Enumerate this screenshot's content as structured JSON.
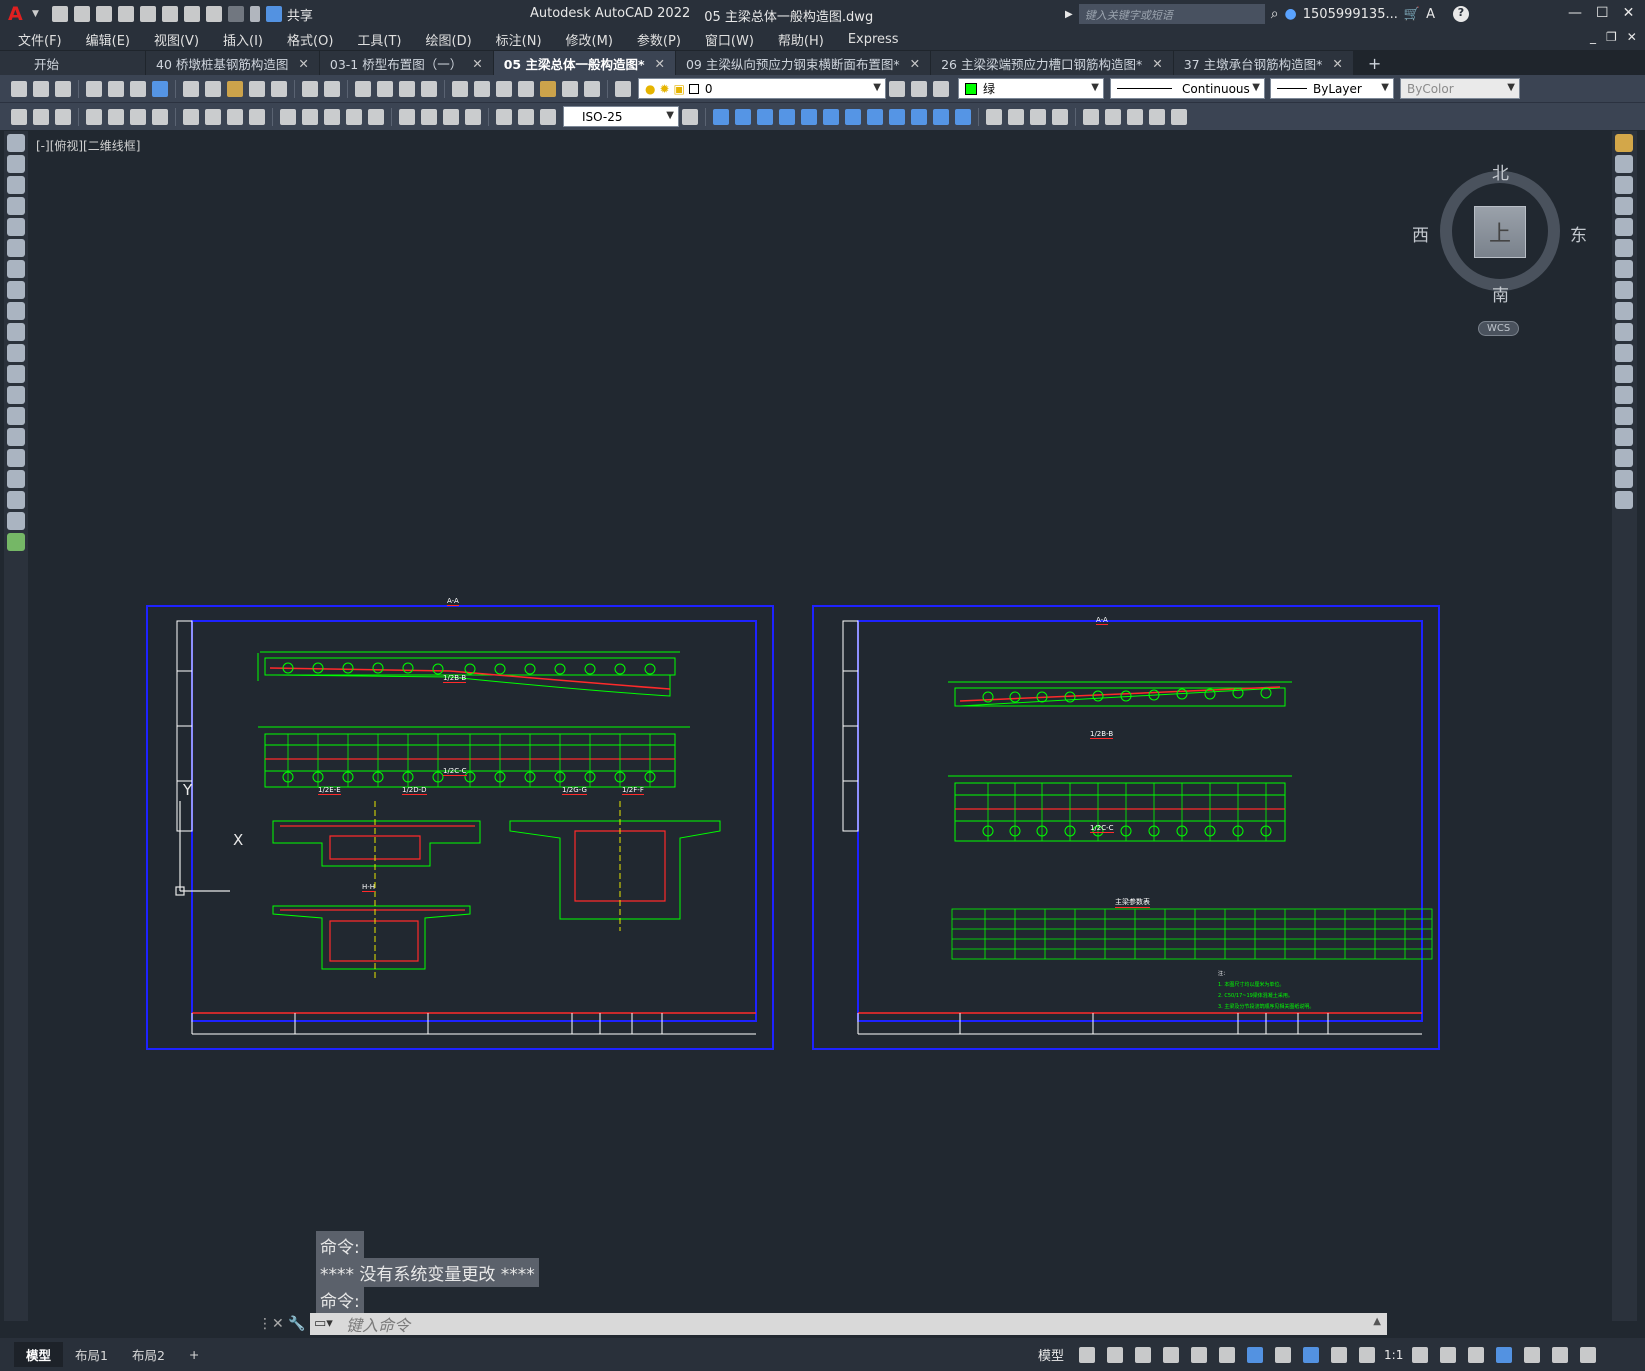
{
  "app": {
    "logo": "A",
    "title": "Autodesk AutoCAD 2022",
    "document": "05 主梁总体一般构造图.dwg",
    "share_label": "共享",
    "search_placeholder": "键入关键字或短语",
    "user": "1505999135...",
    "help": "?"
  },
  "menu": [
    "文件(F)",
    "编辑(E)",
    "视图(V)",
    "插入(I)",
    "格式(O)",
    "工具(T)",
    "绘图(D)",
    "标注(N)",
    "修改(M)",
    "参数(P)",
    "窗口(W)",
    "帮助(H)",
    "Express"
  ],
  "tabs": [
    {
      "label": "开始",
      "active": false,
      "closable": false
    },
    {
      "label": "40 桥墩桩基钢筋构造图",
      "active": false,
      "closable": true
    },
    {
      "label": "03-1 桥型布置图（一）",
      "active": false,
      "closable": true
    },
    {
      "label": "05 主梁总体一般构造图*",
      "active": true,
      "closable": true
    },
    {
      "label": "09 主梁纵向预应力钢束横断面布置图*",
      "active": false,
      "closable": true
    },
    {
      "label": "26 主梁梁端预应力槽口钢筋构造图*",
      "active": false,
      "closable": true
    },
    {
      "label": "37 主墩承台钢筋构造图*",
      "active": false,
      "closable": true
    }
  ],
  "tab_close": "✕",
  "new_tab": "+",
  "toolbar": {
    "layer": "0",
    "color": "绿",
    "linetype": "Continuous",
    "lineweight": "ByLayer",
    "plotstyle": "ByColor",
    "dimstyle": "ISO-25"
  },
  "viewport": {
    "label": "[-][俯视][二维线框]"
  },
  "viewcube": {
    "north": "北",
    "south": "南",
    "east": "东",
    "west": "西",
    "top": "上",
    "wcs": "WCS"
  },
  "ucs": {
    "x": "X",
    "y": "Y"
  },
  "drawing": {
    "left": {
      "views": [
        "A-A",
        "1/2B-B",
        "1/2C-C",
        "1/2E-E",
        "1/2D-D",
        "1/2G-G",
        "1/2F-F",
        "H-H"
      ]
    },
    "right": {
      "views": [
        "A-A",
        "1/2B-B",
        "1/2C-C"
      ],
      "table_title": "主梁参数表",
      "notes": [
        "注：",
        "1. 本图尺寸均以厘米为单位。",
        "2. C50/17~19梁体混凝土采用。",
        "3. 主梁及分节段浇筑顺序见相关图纸说明。"
      ]
    }
  },
  "command": {
    "history": [
      "命令:",
      "**** 没有系统变量更改 ****",
      "命令:"
    ],
    "placeholder": "键入命令"
  },
  "layouts": [
    "模型",
    "布局1",
    "布局2"
  ],
  "layout_add": "+",
  "status": {
    "model": "模型",
    "scale": "1:1"
  },
  "colors": {
    "accent": "#5aa3ff",
    "frame": "#1e22ff",
    "drawing": "#00ff00",
    "section": "#ff2a2a",
    "bg": "#212830"
  }
}
